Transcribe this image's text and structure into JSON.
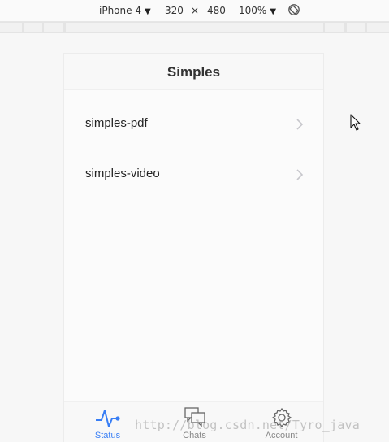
{
  "devtools": {
    "device": "iPhone 4",
    "width": "320",
    "times": "×",
    "height": "480",
    "zoom": "100%"
  },
  "navbar": {
    "title": "Simples"
  },
  "list": [
    {
      "label": "simples-pdf"
    },
    {
      "label": "simples-video"
    }
  ],
  "tabs": [
    {
      "label": "Status",
      "icon": "pulse-icon",
      "active": true
    },
    {
      "label": "Chats",
      "icon": "chats-icon",
      "active": false
    },
    {
      "label": "Account",
      "icon": "gear-icon",
      "active": false
    }
  ],
  "colors": {
    "accent": "#387ef5",
    "inactive": "#888888"
  },
  "watermark": "http://blog.csdn.net/Tyro_java"
}
